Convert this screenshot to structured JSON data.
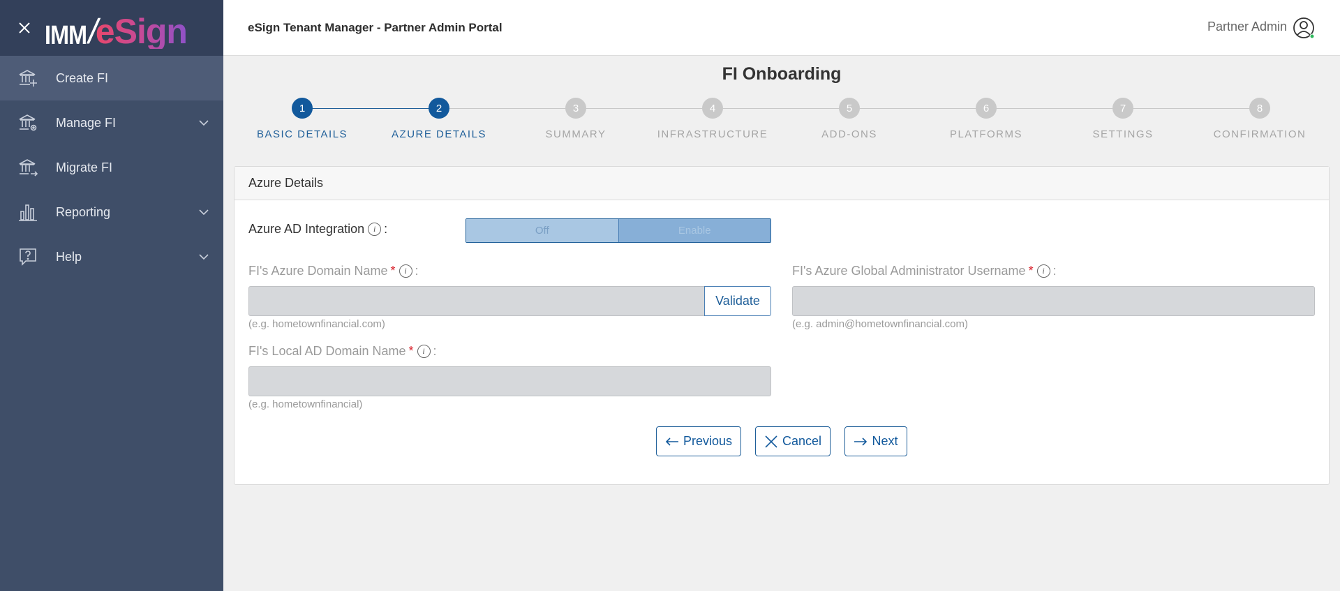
{
  "sidebar": {
    "logo": {
      "part1": "IMM",
      "slash": "/",
      "part2": "eSign"
    },
    "items": [
      {
        "label": "Create FI",
        "icon": "bank-add-icon",
        "active": true
      },
      {
        "label": "Manage FI",
        "icon": "bank-settings-icon",
        "has_chevron": true
      },
      {
        "label": "Migrate FI",
        "icon": "bank-transfer-icon"
      },
      {
        "label": "Reporting",
        "icon": "bar-chart-icon",
        "has_chevron": true
      },
      {
        "label": "Help",
        "icon": "help-chat-icon",
        "has_chevron": true
      }
    ]
  },
  "header": {
    "title": "eSign Tenant Manager - Partner Admin Portal",
    "user_name": "Partner Admin"
  },
  "page": {
    "title": "FI Onboarding"
  },
  "stepper": {
    "steps": [
      {
        "number": "1",
        "label": "BASIC DETAILS",
        "active": true
      },
      {
        "number": "2",
        "label": "AZURE DETAILS",
        "active": true
      },
      {
        "number": "3",
        "label": "SUMMARY",
        "active": false
      },
      {
        "number": "4",
        "label": "INFRASTRUCTURE",
        "active": false
      },
      {
        "number": "5",
        "label": "ADD-ONS",
        "active": false
      },
      {
        "number": "6",
        "label": "PLATFORMS",
        "active": false
      },
      {
        "number": "7",
        "label": "SETTINGS",
        "active": false
      },
      {
        "number": "8",
        "label": "CONFIRMATION",
        "active": false
      }
    ]
  },
  "form": {
    "section_title": "Azure Details",
    "azure_ad": {
      "label": "Azure AD Integration",
      "colon": ":",
      "option_off": "Off",
      "option_enable": "Enable"
    },
    "domain_name": {
      "label": "FI's Azure Domain Name",
      "required_mark": "*",
      "colon": ":",
      "value": "",
      "hint": "(e.g. hometownfinancial.com)",
      "validate_label": "Validate"
    },
    "admin_username": {
      "label": "FI's Azure Global Administrator Username",
      "required_mark": "*",
      "colon": ":",
      "value": "",
      "hint": "(e.g. admin@hometownfinancial.com)"
    },
    "local_domain": {
      "label": "FI's Local AD Domain Name",
      "required_mark": "*",
      "colon": ":",
      "value": "",
      "hint": "(e.g. hometownfinancial)"
    },
    "info_glyph": "i"
  },
  "actions": {
    "previous": "Previous",
    "cancel": "Cancel",
    "next": "Next"
  },
  "colors": {
    "sidebar_bg": "#3f4e68",
    "accent": "#12599c",
    "required": "#d9232d",
    "disabled_input": "#d6d8db"
  }
}
